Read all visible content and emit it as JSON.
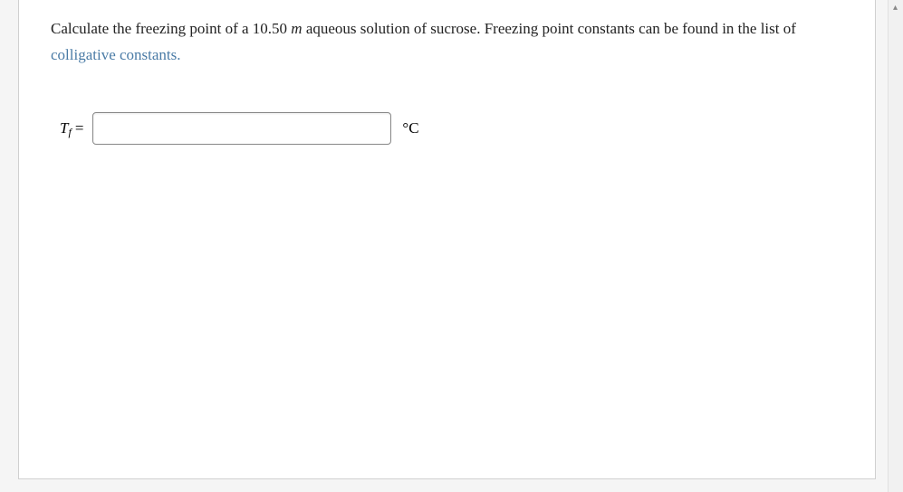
{
  "question": {
    "text_part1": "Calculate the freezing point of a 10.50 ",
    "molal_symbol": "m",
    "text_part2": " aqueous solution of sucrose. Freezing point constants can be found in the list of ",
    "link_text": "colligative constants.",
    "text_part3": ""
  },
  "input": {
    "variable_main": "T",
    "variable_sub": "f",
    "equals": " =",
    "value": "",
    "unit": "°C"
  },
  "scrollbar": {
    "arrow_up": "▴"
  }
}
